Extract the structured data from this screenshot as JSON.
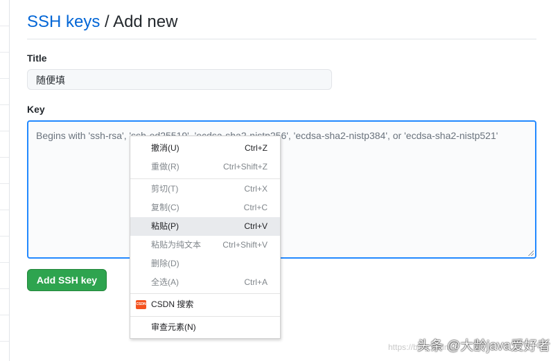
{
  "header": {
    "link": "SSH keys",
    "separator": "/",
    "current": "Add new"
  },
  "form": {
    "title_label": "Title",
    "title_value": "随便填",
    "key_label": "Key",
    "key_placeholder": "Begins with 'ssh-rsa', 'ssh-ed25519', 'ecdsa-sha2-nistp256', 'ecdsa-sha2-nistp384', or 'ecdsa-sha2-nistp521'",
    "submit_label": "Add SSH key"
  },
  "context_menu": {
    "items": [
      {
        "label": "撤消(U)",
        "shortcut": "Ctrl+Z",
        "disabled": false
      },
      {
        "label": "重做(R)",
        "shortcut": "Ctrl+Shift+Z",
        "disabled": true
      },
      {
        "label": "剪切(T)",
        "shortcut": "Ctrl+X",
        "disabled": true
      },
      {
        "label": "复制(C)",
        "shortcut": "Ctrl+C",
        "disabled": true
      },
      {
        "label": "粘贴(P)",
        "shortcut": "Ctrl+V",
        "disabled": false,
        "highlighted": true
      },
      {
        "label": "粘贴为纯文本",
        "shortcut": "Ctrl+Shift+V",
        "disabled": true
      },
      {
        "label": "删除(D)",
        "shortcut": "",
        "disabled": true
      },
      {
        "label": "全选(A)",
        "shortcut": "Ctrl+A",
        "disabled": true
      },
      {
        "label": "CSDN 搜索",
        "shortcut": "",
        "disabled": false,
        "icon": "csdn-icon"
      },
      {
        "label": "审查元素(N)",
        "shortcut": "",
        "disabled": false
      }
    ]
  },
  "watermark": {
    "text": "头条 @大龄java爱好者",
    "url_fragment": "https://blog.csdn."
  },
  "colors": {
    "link": "#0366d6",
    "button": "#2ea44f",
    "focus": "#2188ff"
  }
}
